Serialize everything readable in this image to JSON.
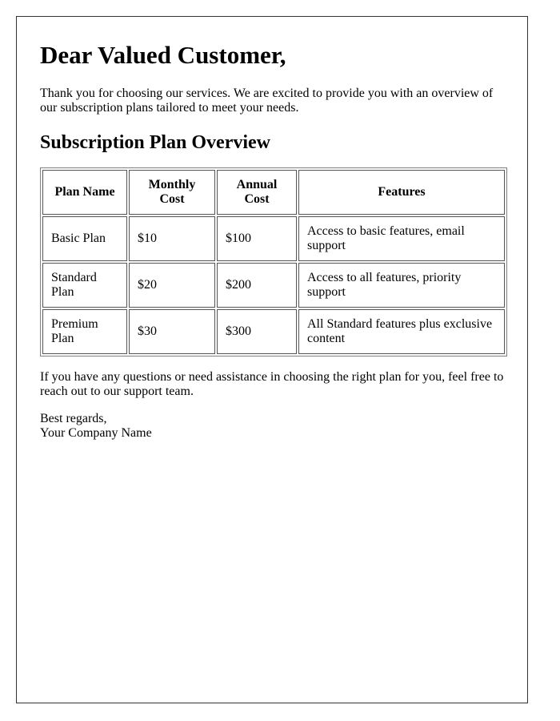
{
  "letter": {
    "greeting": "Dear Valued Customer,",
    "intro": "Thank you for choosing our services. We are excited to provide you with an overview of our subscription plans tailored to meet your needs.",
    "section_title": "Subscription Plan Overview",
    "table": {
      "headers": [
        "Plan Name",
        "Monthly Cost",
        "Annual Cost",
        "Features"
      ],
      "rows": [
        [
          "Basic Plan",
          "$10",
          "$100",
          "Access to basic features, email support"
        ],
        [
          "Standard Plan",
          "$20",
          "$200",
          "Access to all features, priority support"
        ],
        [
          "Premium Plan",
          "$30",
          "$300",
          "All Standard features plus exclusive content"
        ]
      ]
    },
    "outro": "If you have any questions or need assistance in choosing the right plan for you, feel free to reach out to our support team.",
    "closing": "Best regards,",
    "signature": "Your Company Name"
  }
}
